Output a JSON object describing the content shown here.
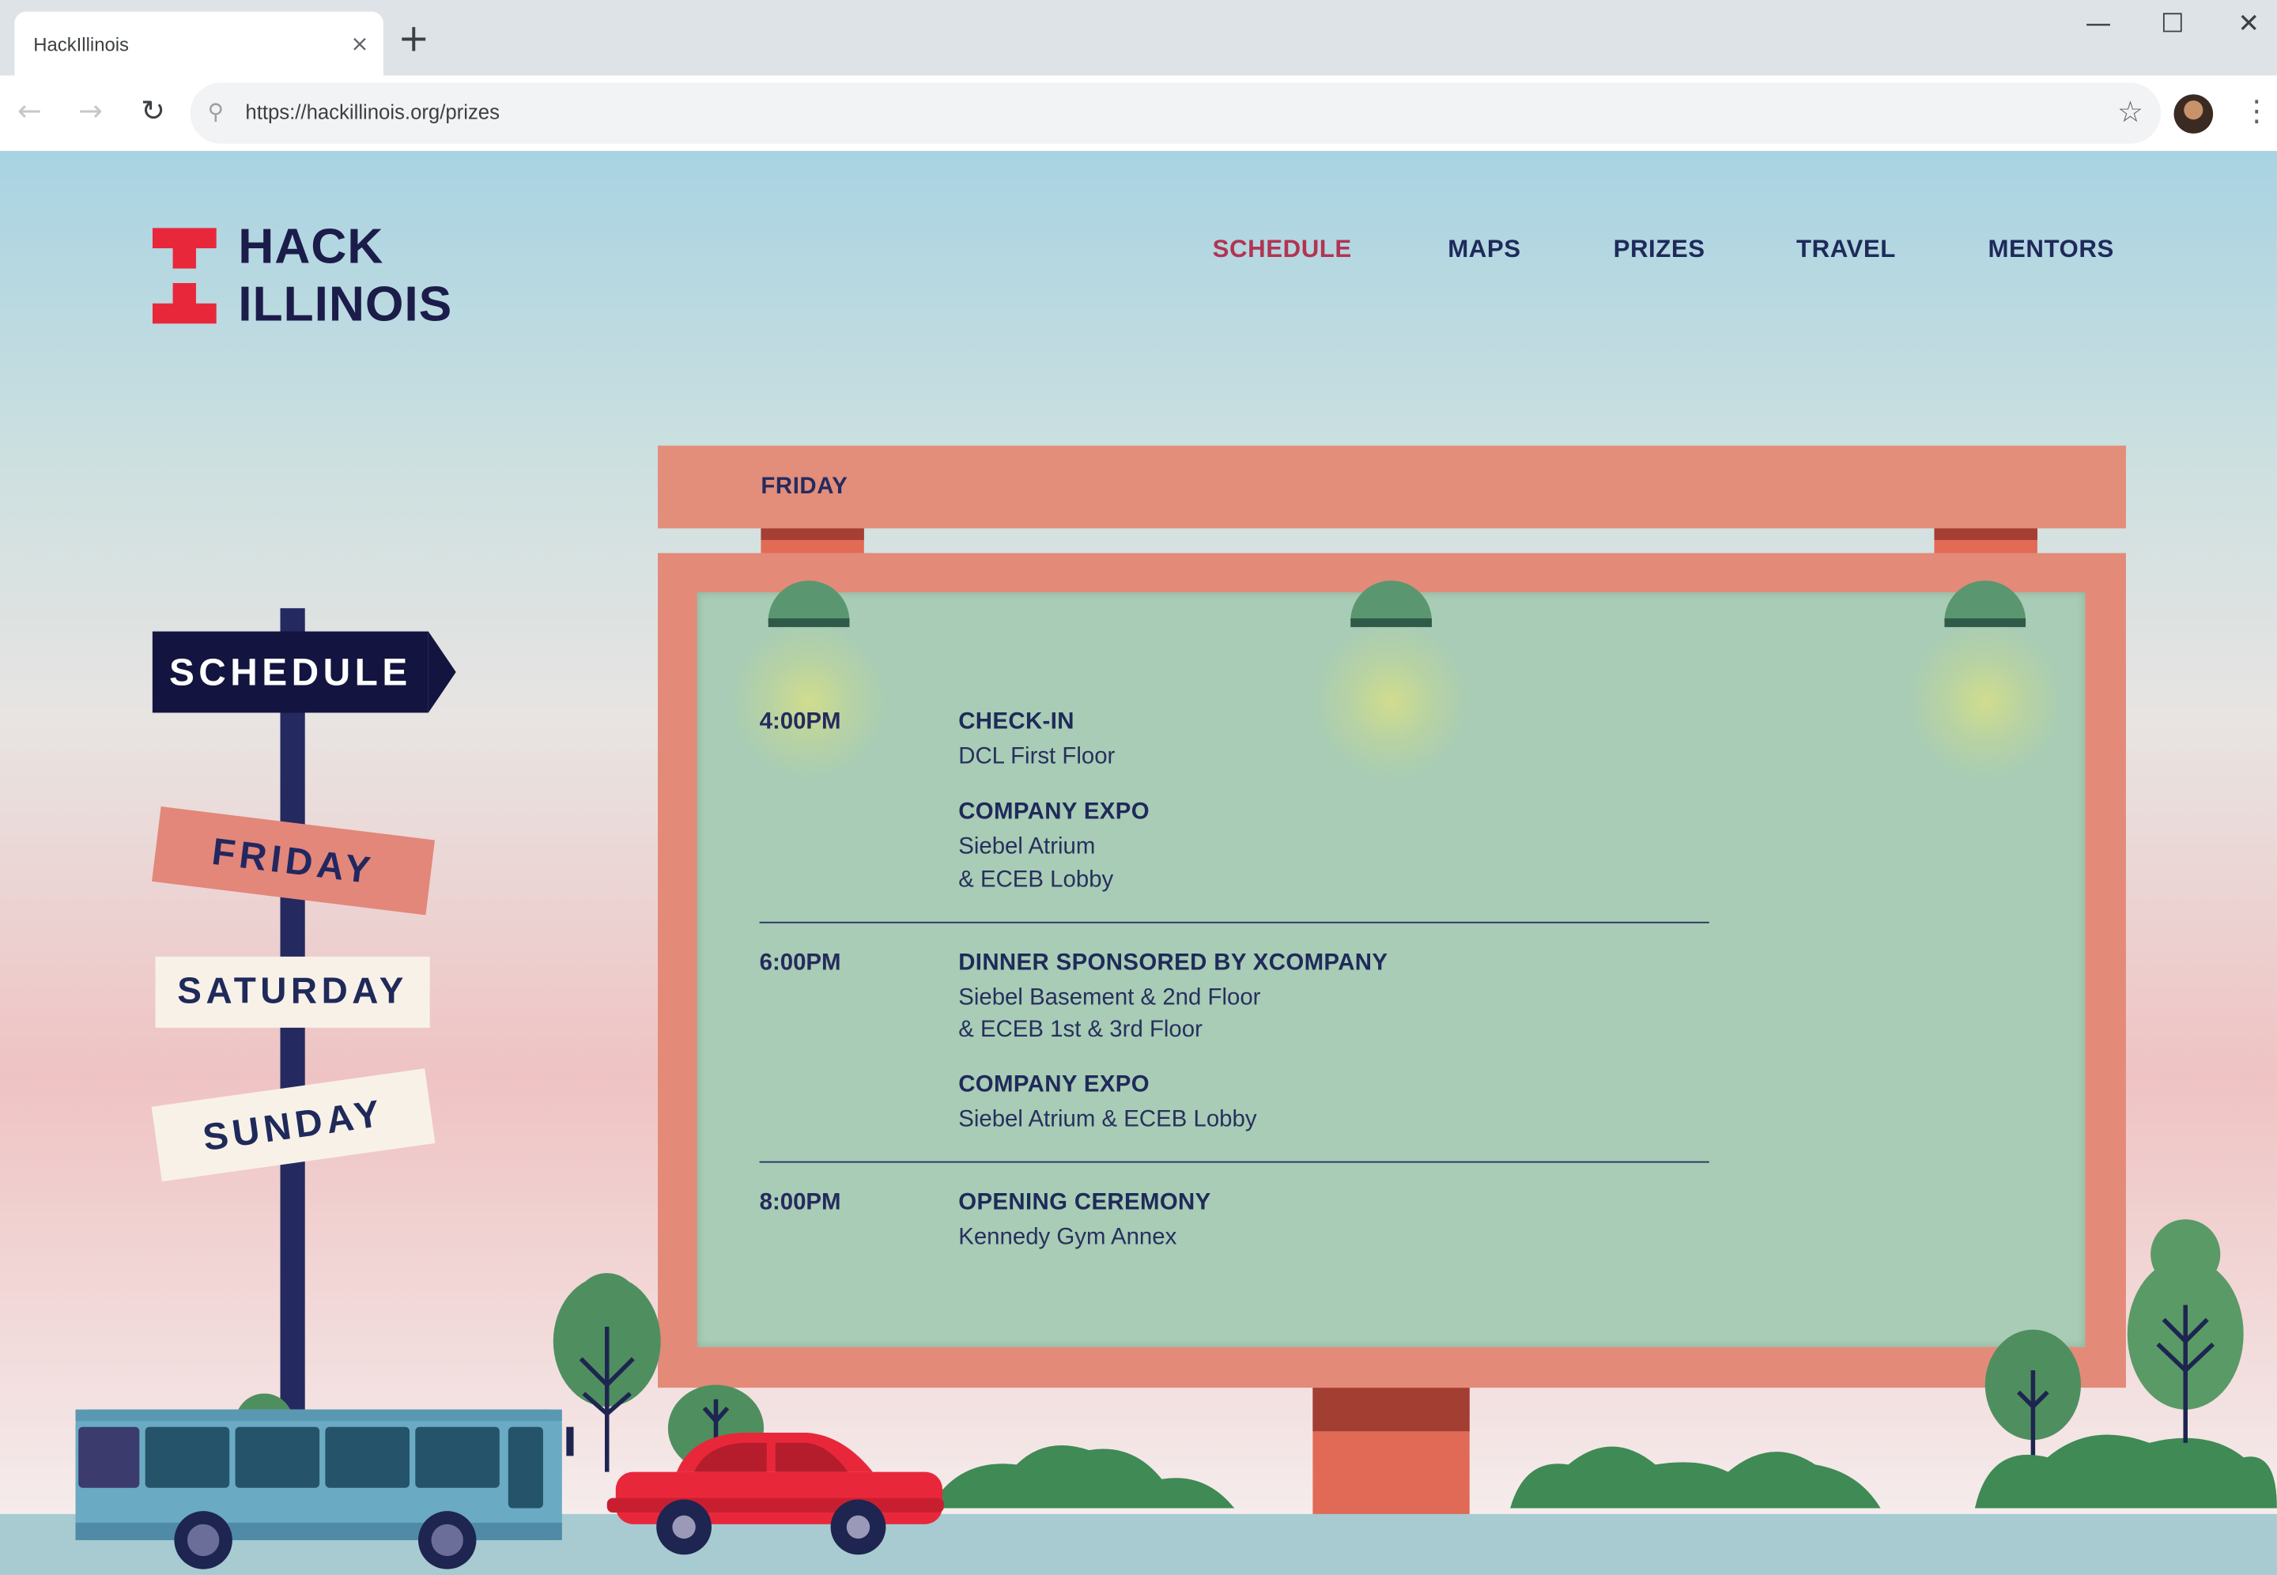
{
  "browser": {
    "tab_title": "HackIllinois",
    "tab_close": "×",
    "new_tab": "+",
    "url": "https://hackillinois.org/prizes",
    "window_controls": {
      "minimize": "—",
      "maximize": "☐",
      "close": "✕"
    },
    "icons": [
      "back-arrow-icon",
      "forward-arrow-icon",
      "reload-icon",
      "search-icon",
      "star-icon",
      "kebab-menu-icon"
    ]
  },
  "site": {
    "logo": {
      "line1": "HACK",
      "line2": "ILLINOIS"
    },
    "nav": [
      {
        "label": "SCHEDULE",
        "active": true
      },
      {
        "label": "MAPS"
      },
      {
        "label": "PRIZES"
      },
      {
        "label": "TRAVEL"
      },
      {
        "label": "MENTORS"
      }
    ],
    "signpost": {
      "schedule": "SCHEDULE",
      "friday": "FRIDAY",
      "saturday": "SATURDAY",
      "sunday": "SUNDAY"
    },
    "billboard": {
      "day": "FRIDAY",
      "slots": [
        {
          "time": "4:00PM",
          "events": [
            {
              "title": "CHECK-IN",
              "location": [
                "DCL First Floor"
              ]
            },
            {
              "title": "COMPANY EXPO",
              "location": [
                "Siebel Atrium",
                "& ECEB Lobby"
              ]
            }
          ]
        },
        {
          "time": "6:00PM",
          "events": [
            {
              "title": "DINNER SPONSORED BY XCOMPANY",
              "location": [
                "Siebel Basement & 2nd Floor",
                "& ECEB 1st & 3rd Floor"
              ]
            },
            {
              "title": "COMPANY EXPO",
              "location": [
                "Siebel Atrium & ECEB Lobby"
              ]
            }
          ]
        },
        {
          "time": "8:00PM",
          "events": [
            {
              "title": "OPENING CEREMONY",
              "location": [
                "Kennedy Gym Annex"
              ]
            }
          ]
        }
      ]
    }
  },
  "colors": {
    "brand_red": "#e8283a",
    "navy": "#1f2a5a",
    "active_nav": "#b23452",
    "billboard_frame": "#e38a79",
    "billboard_screen": "#a8ccb5"
  }
}
